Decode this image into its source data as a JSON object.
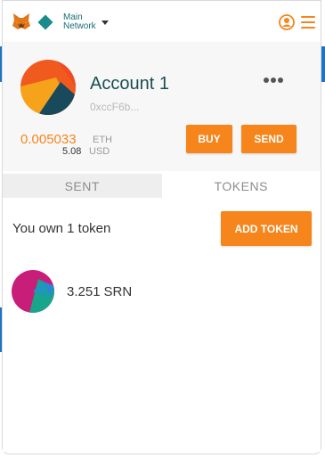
{
  "header": {
    "network_line1": "Main",
    "network_line2": "Network"
  },
  "account": {
    "name": "Account 1",
    "address": "0xccF6b...",
    "balance_eth": "0.005033",
    "eth_unit": "ETH",
    "balance_usd": "5.08",
    "usd_unit": "USD",
    "buy_label": "BUY",
    "send_label": "SEND"
  },
  "tabs": [
    {
      "label": "SENT",
      "active": false
    },
    {
      "label": "TOKENS",
      "active": true
    }
  ],
  "tokens": {
    "summary": "You own 1 token",
    "add_label": "ADD TOKEN",
    "items": [
      {
        "amount": "3.251",
        "symbol": "SRN"
      }
    ]
  },
  "colors": {
    "accent": "#f6851b",
    "name": "#1a4e55",
    "network": "#1a8a8a"
  }
}
